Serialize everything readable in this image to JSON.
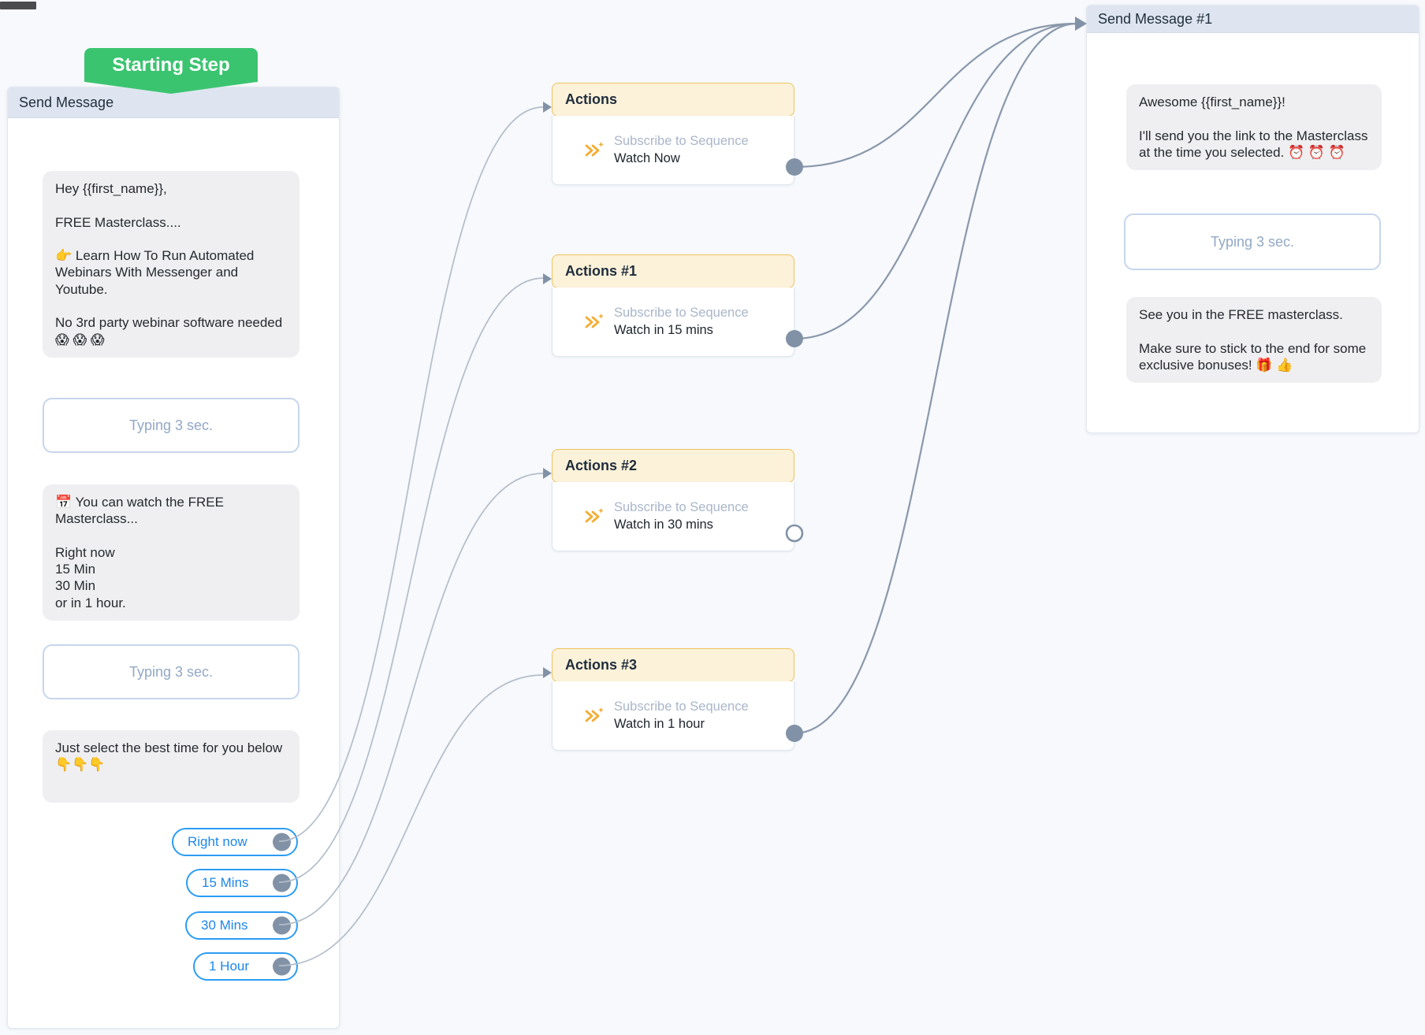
{
  "badge": {
    "label": "Starting Step"
  },
  "left_card": {
    "title": "Send Message",
    "bubble1": "Hey {{first_name}},\n\nFREE Masterclass....\n\n👉 Learn How To Run Automated Webinars With Messenger and Youtube.\n\nNo 3rd party webinar software needed\n😱 😱 😱",
    "typing1": "Typing 3 sec.",
    "bubble2": "📅 You can watch the FREE Masterclass...\n\nRight now\n15 Min\n30 Min\nor in 1 hour.",
    "typing2": "Typing 3 sec.",
    "bubble3": "Just select the best time for you below 👇👇👇",
    "buttons": [
      {
        "label": "Right now"
      },
      {
        "label": "15 Mins"
      },
      {
        "label": "30 Mins"
      },
      {
        "label": "1 Hour"
      }
    ]
  },
  "action_cards": [
    {
      "title": "Actions",
      "action_label": "Subscribe to Sequence",
      "action_value": "Watch Now"
    },
    {
      "title": "Actions #1",
      "action_label": "Subscribe to Sequence",
      "action_value": "Watch in 15 mins"
    },
    {
      "title": "Actions #2",
      "action_label": "Subscribe to Sequence",
      "action_value": "Watch in 30 mins"
    },
    {
      "title": "Actions #3",
      "action_label": "Subscribe to Sequence",
      "action_value": "Watch in 1 hour"
    }
  ],
  "right_card": {
    "title": "Send Message #1",
    "bubble1": "Awesome {{first_name}}!\n\nI'll send you the link to the Masterclass at the time you selected. ⏰ ⏰ ⏰",
    "typing": "Typing 3 sec.",
    "bubble2": "See you in the FREE masterclass.\n\nMake sure to stick to the end for some exclusive bonuses! 🎁 👍"
  },
  "colors": {
    "accent_green": "#3bc470",
    "accent_blue": "#2b9cf4",
    "port_gray": "#8292a6",
    "actions_yellow": "#edc35d",
    "wire_gray": "#8a98ac"
  }
}
